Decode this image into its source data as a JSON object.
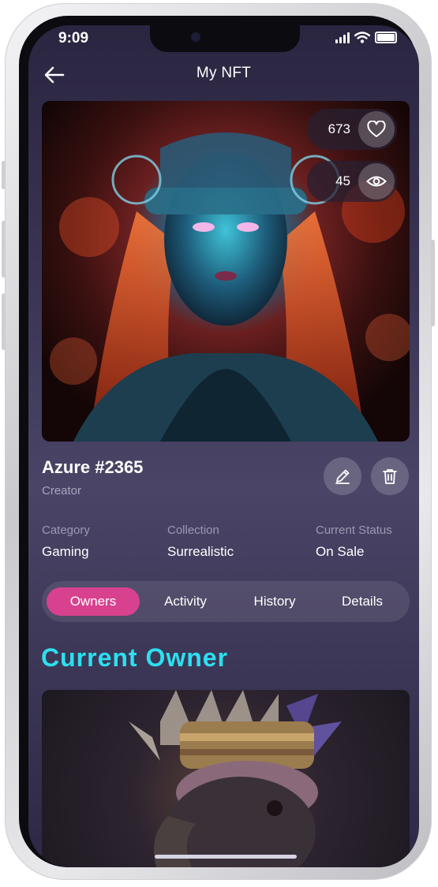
{
  "status_bar": {
    "time": "9:09"
  },
  "header": {
    "title": "My NFT"
  },
  "hero": {
    "likes": "673",
    "views": "45"
  },
  "nft": {
    "name": "Azure #2365",
    "creator_label": "Creator"
  },
  "meta": {
    "category_label": "Category",
    "category_value": "Gaming",
    "collection_label": "Collection",
    "collection_value": "Surrealistic",
    "status_label": "Current Status",
    "status_value": "On Sale"
  },
  "tabs": [
    {
      "label": "Owners",
      "active": true
    },
    {
      "label": "Activity",
      "active": false
    },
    {
      "label": "History",
      "active": false
    },
    {
      "label": "Details",
      "active": false
    }
  ],
  "section": {
    "title": "Current Owner"
  },
  "colors": {
    "accent_pink": "#d8418d",
    "accent_cyan": "#2ce0f0"
  },
  "icons": {
    "back": "arrow-left-icon",
    "like": "heart-icon",
    "view": "eye-icon",
    "edit": "pencil-icon",
    "delete": "trash-icon"
  }
}
